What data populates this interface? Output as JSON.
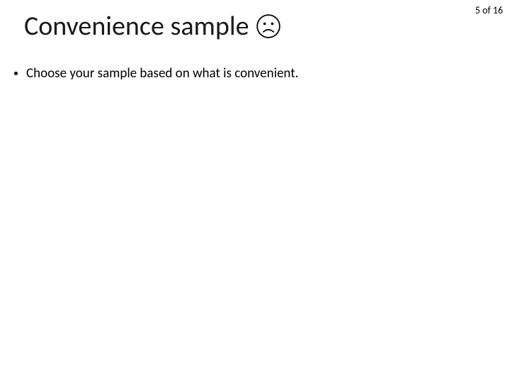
{
  "pagination": {
    "label": "5 of 16"
  },
  "title": {
    "text": "Convenience sample",
    "icon_name": "sad-face-icon"
  },
  "bullets": [
    {
      "text": "Choose your sample based on what is convenient."
    }
  ]
}
